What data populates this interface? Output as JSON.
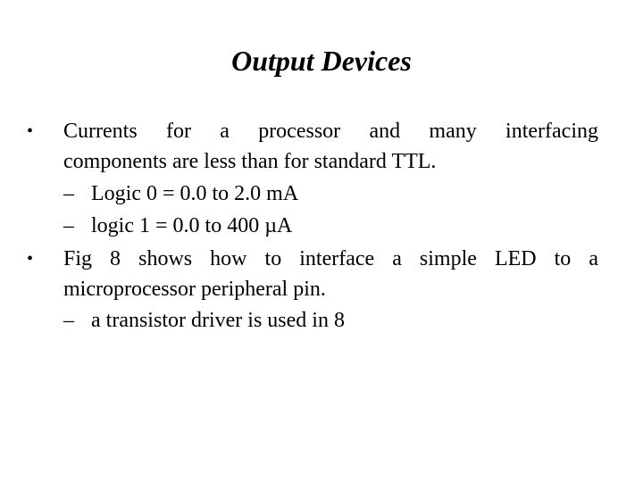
{
  "slide": {
    "title": "Output Devices",
    "bullets": [
      {
        "line1": "Currents for a processor and many interfacing",
        "line2": "components are less than for standard TTL.",
        "sub": [
          "Logic 0 = 0.0 to 2.0 mA",
          "logic 1 = 0.0 to 400 µA"
        ]
      },
      {
        "line1": "Fig 8 shows how to interface a simple LED to a",
        "line2": "microprocessor peripheral pin.",
        "sub": [
          "a transistor driver is used in 8"
        ]
      }
    ],
    "bullet_glyph": "•",
    "dash_glyph": "–"
  }
}
